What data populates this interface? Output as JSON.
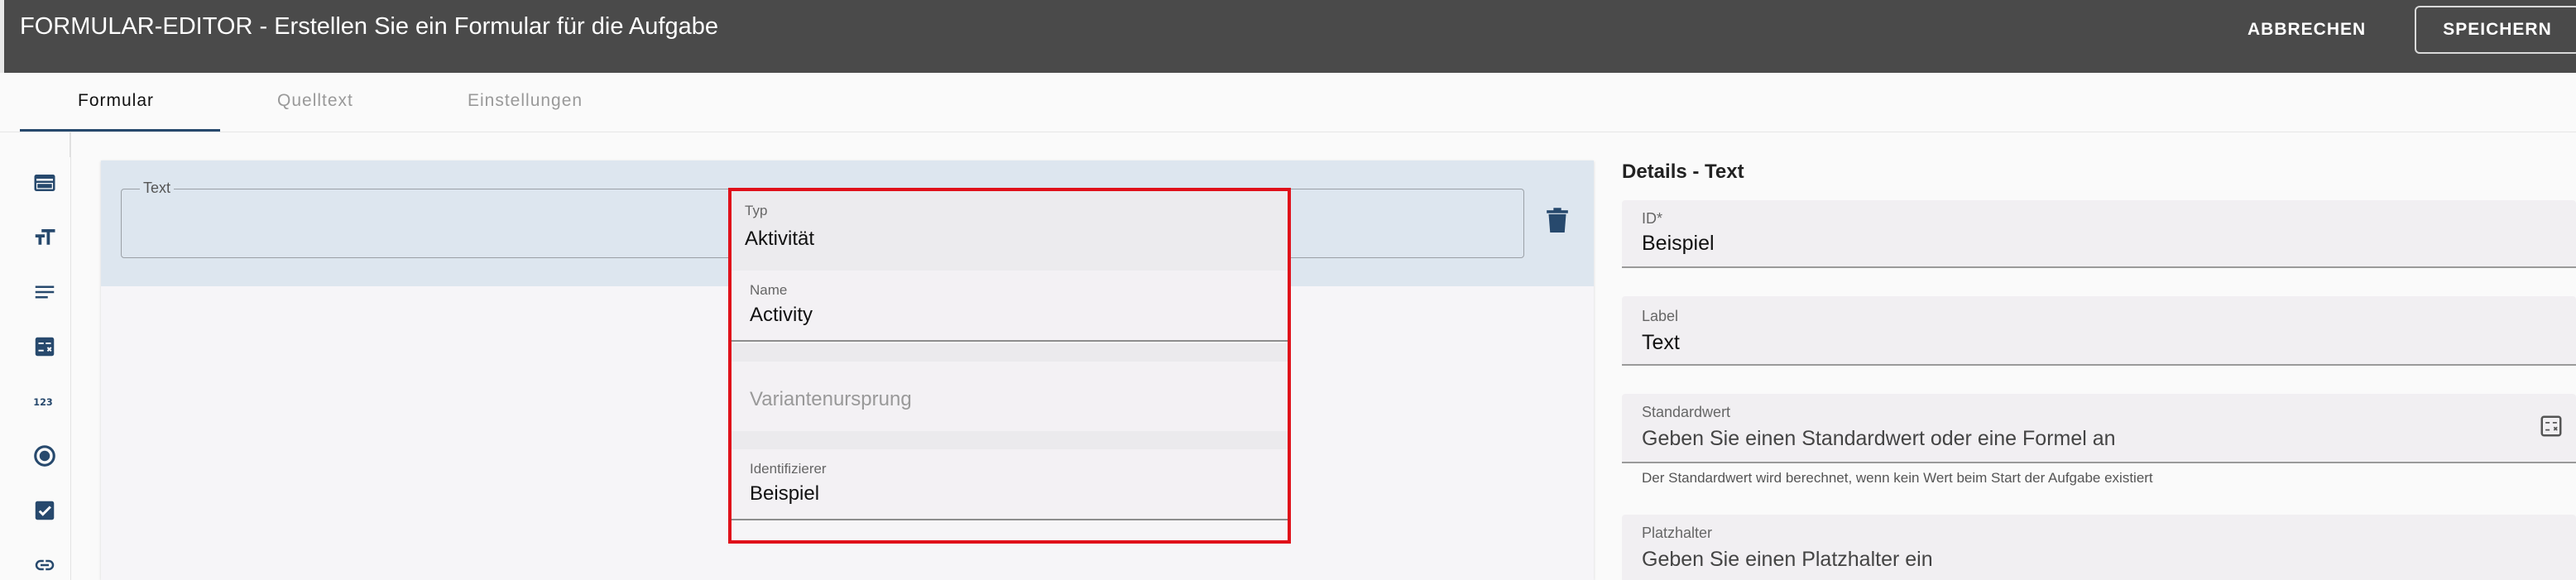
{
  "header": {
    "title": "FORMULAR-EDITOR - Erstellen Sie ein Formular für die Aufgabe",
    "cancel_label": "ABBRECHEN",
    "save_label": "SPEICHERN"
  },
  "tabs": [
    {
      "label": "Formular",
      "active": true
    },
    {
      "label": "Quelltext",
      "active": false
    },
    {
      "label": "Einstellungen",
      "active": false
    }
  ],
  "toolbar": {
    "icons": [
      "card-icon",
      "text-size-icon",
      "paragraph-icon",
      "calculator-icon",
      "number-icon",
      "radio-icon",
      "checkbox-icon",
      "link-icon"
    ]
  },
  "canvas": {
    "field_legend": "Text"
  },
  "dropdown": {
    "type_label": "Typ",
    "type_value": "Aktivität",
    "name_label": "Name",
    "name_value": "Activity",
    "variant_placeholder": "Variantenursprung",
    "identifier_label": "Identifizierer",
    "identifier_value": "Beispiel"
  },
  "details": {
    "title": "Details - Text",
    "id_label": "ID*",
    "id_value": "Beispiel",
    "label_label": "Label",
    "label_value": "Text",
    "default_label": "Standardwert",
    "default_placeholder": "Geben Sie einen Standardwert oder eine Formel an",
    "default_hint": "Der Standardwert wird berechnet, wenn kein Wert beim Start der Aufgabe existiert",
    "placeholder_label": "Platzhalter",
    "placeholder_placeholder": "Geben Sie einen Platzhalter ein"
  },
  "colors": {
    "header_bg": "#4a4a4a",
    "accent": "#27496d",
    "highlight": "#e0101a"
  }
}
